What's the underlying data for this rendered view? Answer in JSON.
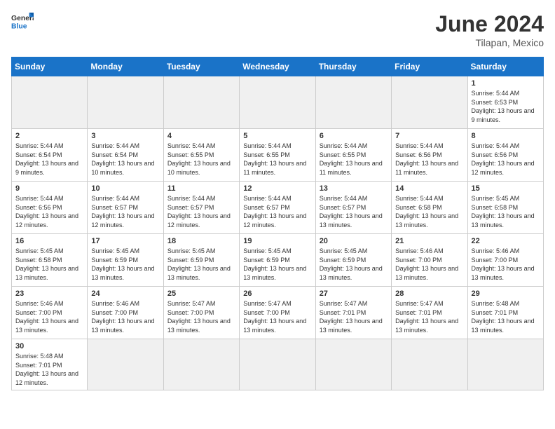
{
  "header": {
    "logo_general": "General",
    "logo_blue": "Blue",
    "month_year": "June 2024",
    "location": "Tilapan, Mexico"
  },
  "days_of_week": [
    "Sunday",
    "Monday",
    "Tuesday",
    "Wednesday",
    "Thursday",
    "Friday",
    "Saturday"
  ],
  "weeks": [
    [
      {
        "day": "",
        "info": ""
      },
      {
        "day": "",
        "info": ""
      },
      {
        "day": "",
        "info": ""
      },
      {
        "day": "",
        "info": ""
      },
      {
        "day": "",
        "info": ""
      },
      {
        "day": "",
        "info": ""
      },
      {
        "day": "1",
        "info": "Sunrise: 5:44 AM\nSunset: 6:53 PM\nDaylight: 13 hours and 9 minutes."
      }
    ],
    [
      {
        "day": "2",
        "info": "Sunrise: 5:44 AM\nSunset: 6:54 PM\nDaylight: 13 hours and 9 minutes."
      },
      {
        "day": "3",
        "info": "Sunrise: 5:44 AM\nSunset: 6:54 PM\nDaylight: 13 hours and 10 minutes."
      },
      {
        "day": "4",
        "info": "Sunrise: 5:44 AM\nSunset: 6:55 PM\nDaylight: 13 hours and 10 minutes."
      },
      {
        "day": "5",
        "info": "Sunrise: 5:44 AM\nSunset: 6:55 PM\nDaylight: 13 hours and 11 minutes."
      },
      {
        "day": "6",
        "info": "Sunrise: 5:44 AM\nSunset: 6:55 PM\nDaylight: 13 hours and 11 minutes."
      },
      {
        "day": "7",
        "info": "Sunrise: 5:44 AM\nSunset: 6:56 PM\nDaylight: 13 hours and 11 minutes."
      },
      {
        "day": "8",
        "info": "Sunrise: 5:44 AM\nSunset: 6:56 PM\nDaylight: 13 hours and 12 minutes."
      }
    ],
    [
      {
        "day": "9",
        "info": "Sunrise: 5:44 AM\nSunset: 6:56 PM\nDaylight: 13 hours and 12 minutes."
      },
      {
        "day": "10",
        "info": "Sunrise: 5:44 AM\nSunset: 6:57 PM\nDaylight: 13 hours and 12 minutes."
      },
      {
        "day": "11",
        "info": "Sunrise: 5:44 AM\nSunset: 6:57 PM\nDaylight: 13 hours and 12 minutes."
      },
      {
        "day": "12",
        "info": "Sunrise: 5:44 AM\nSunset: 6:57 PM\nDaylight: 13 hours and 12 minutes."
      },
      {
        "day": "13",
        "info": "Sunrise: 5:44 AM\nSunset: 6:57 PM\nDaylight: 13 hours and 13 minutes."
      },
      {
        "day": "14",
        "info": "Sunrise: 5:44 AM\nSunset: 6:58 PM\nDaylight: 13 hours and 13 minutes."
      },
      {
        "day": "15",
        "info": "Sunrise: 5:45 AM\nSunset: 6:58 PM\nDaylight: 13 hours and 13 minutes."
      }
    ],
    [
      {
        "day": "16",
        "info": "Sunrise: 5:45 AM\nSunset: 6:58 PM\nDaylight: 13 hours and 13 minutes."
      },
      {
        "day": "17",
        "info": "Sunrise: 5:45 AM\nSunset: 6:59 PM\nDaylight: 13 hours and 13 minutes."
      },
      {
        "day": "18",
        "info": "Sunrise: 5:45 AM\nSunset: 6:59 PM\nDaylight: 13 hours and 13 minutes."
      },
      {
        "day": "19",
        "info": "Sunrise: 5:45 AM\nSunset: 6:59 PM\nDaylight: 13 hours and 13 minutes."
      },
      {
        "day": "20",
        "info": "Sunrise: 5:45 AM\nSunset: 6:59 PM\nDaylight: 13 hours and 13 minutes."
      },
      {
        "day": "21",
        "info": "Sunrise: 5:46 AM\nSunset: 7:00 PM\nDaylight: 13 hours and 13 minutes."
      },
      {
        "day": "22",
        "info": "Sunrise: 5:46 AM\nSunset: 7:00 PM\nDaylight: 13 hours and 13 minutes."
      }
    ],
    [
      {
        "day": "23",
        "info": "Sunrise: 5:46 AM\nSunset: 7:00 PM\nDaylight: 13 hours and 13 minutes."
      },
      {
        "day": "24",
        "info": "Sunrise: 5:46 AM\nSunset: 7:00 PM\nDaylight: 13 hours and 13 minutes."
      },
      {
        "day": "25",
        "info": "Sunrise: 5:47 AM\nSunset: 7:00 PM\nDaylight: 13 hours and 13 minutes."
      },
      {
        "day": "26",
        "info": "Sunrise: 5:47 AM\nSunset: 7:00 PM\nDaylight: 13 hours and 13 minutes."
      },
      {
        "day": "27",
        "info": "Sunrise: 5:47 AM\nSunset: 7:01 PM\nDaylight: 13 hours and 13 minutes."
      },
      {
        "day": "28",
        "info": "Sunrise: 5:47 AM\nSunset: 7:01 PM\nDaylight: 13 hours and 13 minutes."
      },
      {
        "day": "29",
        "info": "Sunrise: 5:48 AM\nSunset: 7:01 PM\nDaylight: 13 hours and 13 minutes."
      }
    ],
    [
      {
        "day": "30",
        "info": "Sunrise: 5:48 AM\nSunset: 7:01 PM\nDaylight: 13 hours and 12 minutes."
      },
      {
        "day": "",
        "info": ""
      },
      {
        "day": "",
        "info": ""
      },
      {
        "day": "",
        "info": ""
      },
      {
        "day": "",
        "info": ""
      },
      {
        "day": "",
        "info": ""
      },
      {
        "day": "",
        "info": ""
      }
    ]
  ]
}
